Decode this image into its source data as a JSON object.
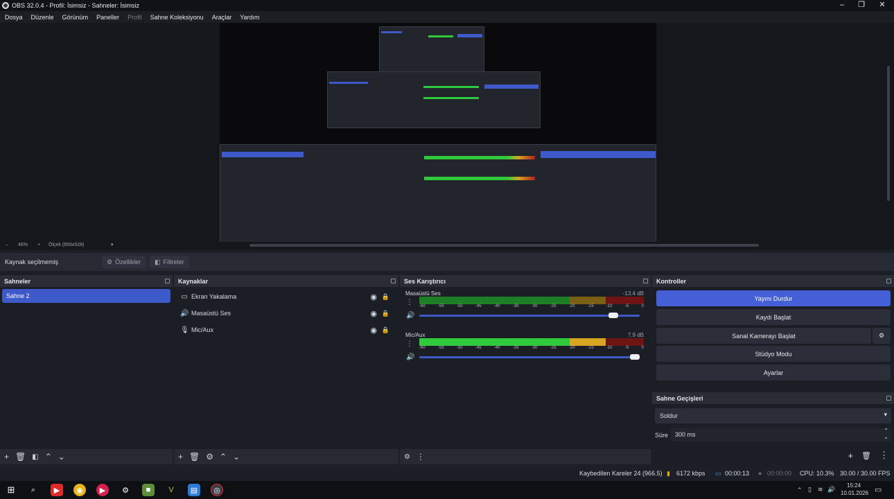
{
  "window": {
    "title": "OBS 32.0.4 - Profil: İsimsiz - Sahneler: İsimsiz"
  },
  "menu": [
    "Dosya",
    "Düzenle",
    "Görünüm",
    "Paneller",
    "Profil",
    "Sahne Koleksiyonu",
    "Araçlar",
    "Yardım"
  ],
  "preview": {
    "zoom": "46%",
    "size_label": "Ölçek (656x528)"
  },
  "context": {
    "status": "Kaynak seçilmemiş",
    "properties": "Özellikler",
    "filters": "Filtreler"
  },
  "scenes": {
    "title": "Sahneler",
    "items": [
      "Sahne 2"
    ]
  },
  "sources": {
    "title": "Kaynaklar",
    "items": [
      {
        "label": "Ekran Yakalama",
        "icon": "monitor-icon"
      },
      {
        "label": "Masaüstü Ses",
        "icon": "speaker-icon"
      },
      {
        "label": "Mic/Aux",
        "icon": "microphone-icon"
      }
    ]
  },
  "mixer": {
    "title": "Ses Karıştırıcı",
    "ticks": [
      "-60",
      "-55",
      "-50",
      "-45",
      "-40",
      "-35",
      "-30",
      "-25",
      "-20",
      "-15",
      "-10",
      "-5",
      "0"
    ],
    "tracks": [
      {
        "name": "Masaüstü Ses",
        "db": "-13.4 dB",
        "level": 0.9,
        "volume": 0.88
      },
      {
        "name": "Mic/Aux",
        "db": "7.9 dB",
        "level": 0.71,
        "volume": 1.0
      }
    ]
  },
  "controls": {
    "title": "Kontroller",
    "stop_stream": "Yayını Durdur",
    "start_record": "Kaydı Başlat",
    "start_virtualcam": "Sanal Kamerayı Başlat",
    "studio_mode": "Stüdyo Modu",
    "settings": "Ayarlar"
  },
  "transitions": {
    "title": "Sahne Geçişleri",
    "selected": "Soldur",
    "duration_label": "Süre",
    "duration": "300 ms"
  },
  "status": {
    "dropped": "Kaybedilen Kareler 24 (966.5)",
    "bitrate": "6172 kbps",
    "stream_time": "00:00:13",
    "record_time": "00:00:00",
    "cpu": "CPU: 10.3%",
    "fps": "30.00 / 30.00 FPS"
  },
  "taskbar": {
    "time": "15:24",
    "date": "10.01.2026"
  },
  "colors": {
    "accent": "#4560d6",
    "meter_green": "#2fc93b",
    "meter_yellow": "#d7a521",
    "meter_red": "#b2201f"
  }
}
